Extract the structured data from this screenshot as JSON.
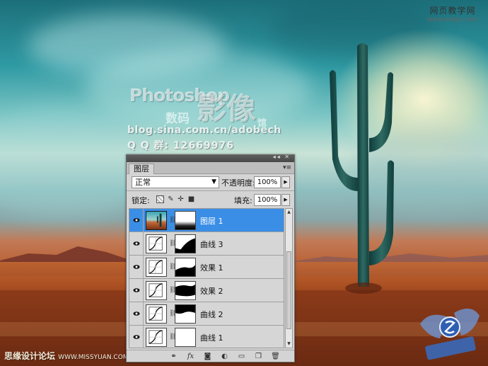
{
  "watermark": {
    "title": "Photoshop",
    "big": "影像",
    "small1": "数码",
    "small2": "馆",
    "url": "blog.sina.com.cn/adobech",
    "qq": "Q Q 群: 12669976"
  },
  "corner_logo": {
    "line1": "网页教学网",
    "line2": "www.webjx.com"
  },
  "forum": {
    "name": "思缘设计论坛",
    "url": "WWW.MISSYUAN.COM"
  },
  "panel": {
    "tab": "图层",
    "blend_mode": "正常",
    "opacity_label": "不透明度:",
    "opacity": "100%",
    "lock_label": "锁定:",
    "fill_label": "填充:",
    "fill": "100%",
    "layers": [
      {
        "name": "图层 1",
        "selected": true,
        "thumb": "photo",
        "mask": "blur-bottom"
      },
      {
        "name": "曲线 3",
        "selected": false,
        "thumb": "curves",
        "mask": "mask-3"
      },
      {
        "name": "效果 1",
        "selected": false,
        "thumb": "curves",
        "mask": "mask-e1"
      },
      {
        "name": "效果 2",
        "selected": false,
        "thumb": "curves",
        "mask": "mask-e2"
      },
      {
        "name": "曲线 2",
        "selected": false,
        "thumb": "curves",
        "mask": "mask-2"
      },
      {
        "name": "曲线 1",
        "selected": false,
        "thumb": "curves",
        "mask": "white"
      }
    ]
  },
  "colors": {
    "selection": "#3b8ee6",
    "panel_bg": "#d4d4d4",
    "titlebar": "#4f4f4f"
  },
  "icons": {
    "visibility": "eye-icon",
    "chain": "chain-link-icon",
    "lock_transparent": "lock-transparent-icon",
    "lock_paint": "brush-icon",
    "lock_position": "move-icon",
    "lock_all": "lock-icon",
    "panel_menu": "panel-menu-icon",
    "bottom": [
      "link-layers-icon",
      "fx-icon",
      "add-mask-icon",
      "adjustment-layer-icon",
      "folder-icon",
      "new-layer-icon",
      "trash-icon"
    ]
  }
}
